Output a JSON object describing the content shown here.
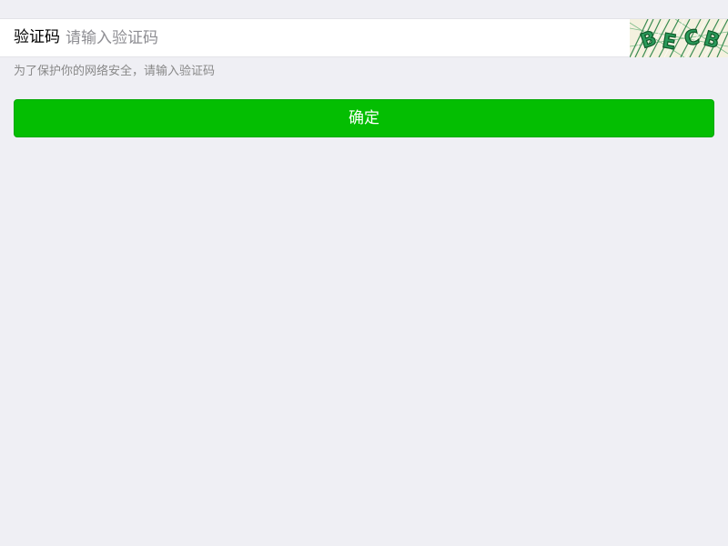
{
  "form": {
    "captcha_label": "验证码",
    "captcha_placeholder": "请输入验证码",
    "captcha_value": "",
    "captcha_image_text": "BECB"
  },
  "hint_text": "为了保护你的网络安全，请输入验证码",
  "confirm_label": "确定",
  "colors": {
    "background": "#efeff4",
    "primary_green": "#04be02",
    "captcha_green": "#1a7a3a",
    "hint_gray": "#888888",
    "placeholder_gray": "#8e8e93"
  }
}
